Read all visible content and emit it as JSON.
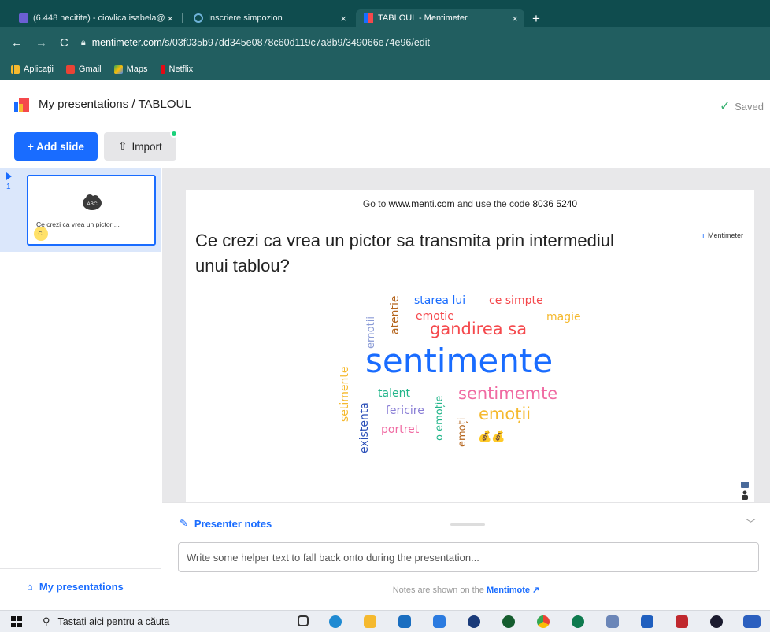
{
  "browser": {
    "tabs": [
      {
        "title": "(6.448 necitite) - ciovlica.isabela@",
        "close": "×"
      },
      {
        "title": "Inscriere simpozion",
        "close": "×"
      },
      {
        "title": "TABLOUL - Mentimeter",
        "close": "×"
      }
    ],
    "new_tab": "+",
    "url_domain": "mentimeter.com",
    "url_path": "/s/03f035b97dd345e0878c60d119c7a8b9/349066e74e96/edit",
    "bookmarks": [
      "Aplicații",
      "Gmail",
      "Maps",
      "Netflix"
    ]
  },
  "header": {
    "breadcrumb": "My presentations / TABLOUL",
    "saved": "Saved"
  },
  "toolbar": {
    "add_slide": "+ Add slide",
    "import": "Import"
  },
  "sidebar": {
    "slide_number": "1",
    "slide_thumb_text": "Ce crezi ca vrea un pictor ...",
    "thumb_avatar": "CI",
    "thumb_icon_label": "ABC",
    "footer": "My presentations"
  },
  "slide": {
    "join_prefix": "Go to ",
    "join_site": "www.menti.com",
    "join_mid": " and use the code ",
    "join_code": "8036 5240",
    "brand": "Mentimeter",
    "question": "Ce crezi ca vrea un pictor sa transmita prin intermediul unui tablou?",
    "wordcloud": [
      {
        "text": "sentimente",
        "color": "#196cff"
      },
      {
        "text": "gandirea sa",
        "color": "#f5484c"
      },
      {
        "text": "sentimemte",
        "color": "#f06aa2"
      },
      {
        "text": "emoții",
        "color": "#f5b92e"
      },
      {
        "text": "starea lui",
        "color": "#196cff"
      },
      {
        "text": "ce simpte",
        "color": "#f5484c"
      },
      {
        "text": "emotie",
        "color": "#f5484c"
      },
      {
        "text": "magie",
        "color": "#f5b92e"
      },
      {
        "text": "atentie",
        "color": "#b5651d"
      },
      {
        "text": "emotii",
        "color": "#8a9bd6"
      },
      {
        "text": "setimente",
        "color": "#f5b92e"
      },
      {
        "text": "existenta",
        "color": "#2b4fb8"
      },
      {
        "text": "talent",
        "color": "#21b58a"
      },
      {
        "text": "fericire",
        "color": "#8a7fd6"
      },
      {
        "text": "portret",
        "color": "#f06aa2"
      },
      {
        "text": "o emoție",
        "color": "#21b58a"
      },
      {
        "text": "emoți",
        "color": "#b5651d"
      }
    ],
    "coins": "💰💰"
  },
  "notes": {
    "title": "Presenter notes",
    "placeholder": "Write some helper text to fall back onto during the presentation...",
    "footer_prefix": "Notes are shown on the ",
    "footer_link": "Mentimote"
  },
  "taskbar": {
    "search": "Tastați aici pentru a căuta"
  },
  "colors": {
    "accent": "#196cff",
    "browser_dark": "#0f4c4e",
    "browser_bar": "#215e60"
  }
}
